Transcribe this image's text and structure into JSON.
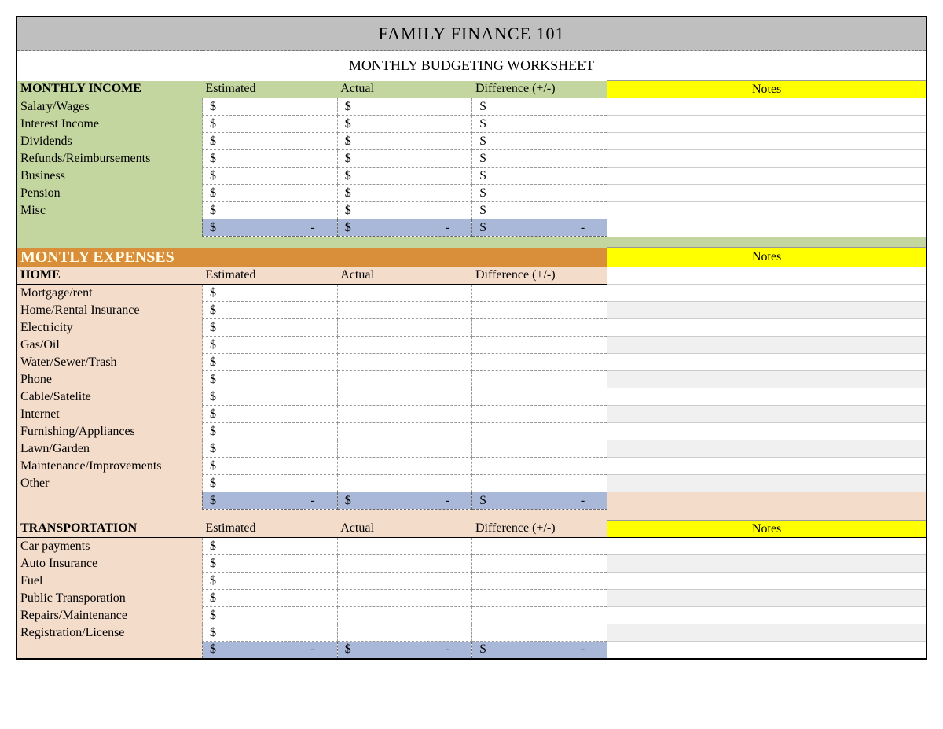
{
  "title": "FAMILY FINANCE 101",
  "subtitle": "MONTHLY BUDGETING WORKSHEET",
  "income": {
    "header": "MONTHLY INCOME",
    "cols": [
      "Estimated",
      "Actual",
      "Difference (+/-)"
    ],
    "notes_hdr": "Notes",
    "rows": [
      "Salary/Wages",
      "Interest Income",
      "Dividends",
      "Refunds/Reimbursements",
      "Business",
      "Pension",
      "Misc"
    ],
    "currency": "$",
    "total_dash": "-"
  },
  "expenses_header": "MONTLY EXPENSES",
  "home": {
    "header": "HOME",
    "cols": [
      "Estimated",
      "Actual",
      "Difference (+/-)"
    ],
    "notes_hdr": "Notes",
    "rows": [
      "Mortgage/rent",
      "Home/Rental Insurance",
      "Electricity",
      "Gas/Oil",
      "Water/Sewer/Trash",
      "Phone",
      "Cable/Satelite",
      "Internet",
      "Furnishing/Appliances",
      "Lawn/Garden",
      "Maintenance/Improvements",
      "Other"
    ],
    "currency": "$",
    "total_dash": "-"
  },
  "transport": {
    "header": "TRANSPORTATION",
    "cols": [
      "Estimated",
      "Actual",
      "Difference (+/-)"
    ],
    "notes_hdr": "Notes",
    "rows": [
      "Car payments",
      "Auto Insurance",
      "Fuel",
      "Public Transporation",
      "Repairs/Maintenance",
      "Registration/License"
    ],
    "currency": "$",
    "total_dash": "-"
  }
}
